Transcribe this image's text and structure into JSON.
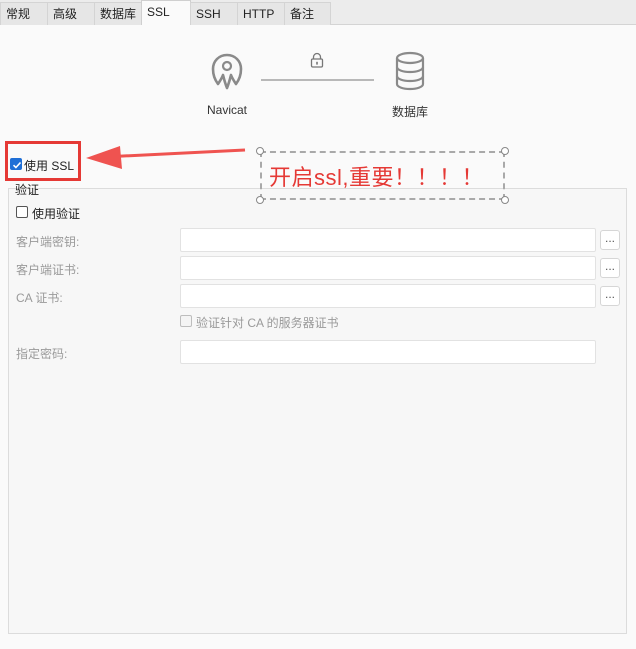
{
  "tabs": [
    {
      "label": "常规",
      "active": false
    },
    {
      "label": "高级",
      "active": false
    },
    {
      "label": "数据库",
      "active": false
    },
    {
      "label": "SSL",
      "active": true
    },
    {
      "label": "SSH",
      "active": false
    },
    {
      "label": "HTTP",
      "active": false
    },
    {
      "label": "备注",
      "active": false
    }
  ],
  "diagram": {
    "client_label": "Navicat",
    "server_label": "数据库",
    "client_icon": "navicat-logo-icon",
    "server_icon": "database-icon",
    "link_icon": "lock-icon"
  },
  "ssl": {
    "use_ssl_label": "使用 SSL",
    "use_ssl_checked": true,
    "auth_group_title": "验证",
    "use_auth_label": "使用验证",
    "use_auth_checked": false,
    "client_key_label": "客户端密钥:",
    "client_key_value": "",
    "client_cert_label": "客户端证书:",
    "client_cert_value": "",
    "ca_cert_label": "CA 证书:",
    "ca_cert_value": "",
    "verify_ca_label": "验证针对 CA 的服务器证书",
    "verify_ca_checked": false,
    "specified_cipher_label": "指定密码:",
    "specified_cipher_value": "",
    "browse_label": "..."
  },
  "annotation": {
    "text": "开启ssl,重要！！！！",
    "color": "#e53935"
  }
}
